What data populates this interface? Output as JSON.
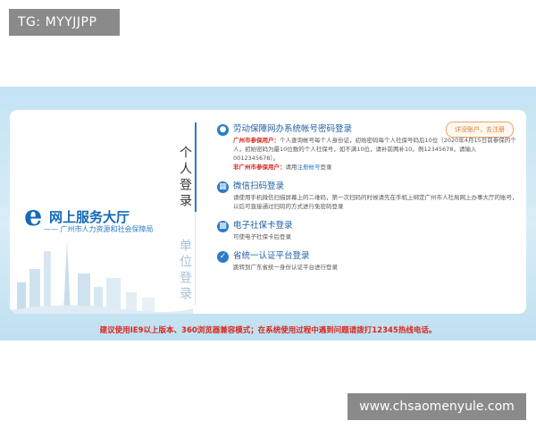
{
  "overlay": {
    "top_badge": "TG: MYYJJPP",
    "watermark": "www.chsaomenyule.com"
  },
  "brand": {
    "logo_letter": "e",
    "title": "网上服务大厅",
    "subtitle": "—— 广州市人力资源和社会保障局"
  },
  "tabs": {
    "personal": "个人登录",
    "unit": "单位登录"
  },
  "help_button": "详没账户，去注册",
  "options": [
    {
      "icon": "person-icon",
      "title": "劳动保障网办系统帐号密码登录",
      "desc": [
        {
          "label": "广州市参保用户：",
          "text": "个人查询帐号每个人身份证，初始密码每个人社保号码后10位（2020年4月15日前参保的个人，初始密码为最10位数的个人社保号，如不满10位，请补前两补10。例12345678，请输入0012345678）。"
        },
        {
          "label": "非广州市参保用户：",
          "text": "请用",
          "link": "注册帐号",
          "text_after": "登录"
        }
      ]
    },
    {
      "icon": "qrcode-icon",
      "title": "微信扫码登录",
      "desc": [
        {
          "text": "请使用手机微信扫描屏幕上的二维码，第一次扫码的时候请先在手机上绑定广州市人社局网上办事大厅的账号，以后可直接通过扫码的方式进行免密码登录"
        }
      ]
    },
    {
      "icon": "card-icon",
      "title": "电子社保卡登录",
      "desc": [
        {
          "text": "可使电子社保卡后登录"
        }
      ]
    },
    {
      "icon": "shield-icon",
      "title": "省统一认证平台登录",
      "desc": [
        {
          "text": "跳转到广东省统一身份认证平台进行登录"
        }
      ]
    }
  ],
  "notice": "建议使用IE9以上版本、360浏览器兼容模式；在系统使用过程中遇到问题请拨打12345热线电话。",
  "colors": {
    "brand_blue": "#1469b8",
    "alert_red": "#d9261c",
    "background_blue": "#c4e3f3",
    "pill_orange": "#e07b27"
  }
}
